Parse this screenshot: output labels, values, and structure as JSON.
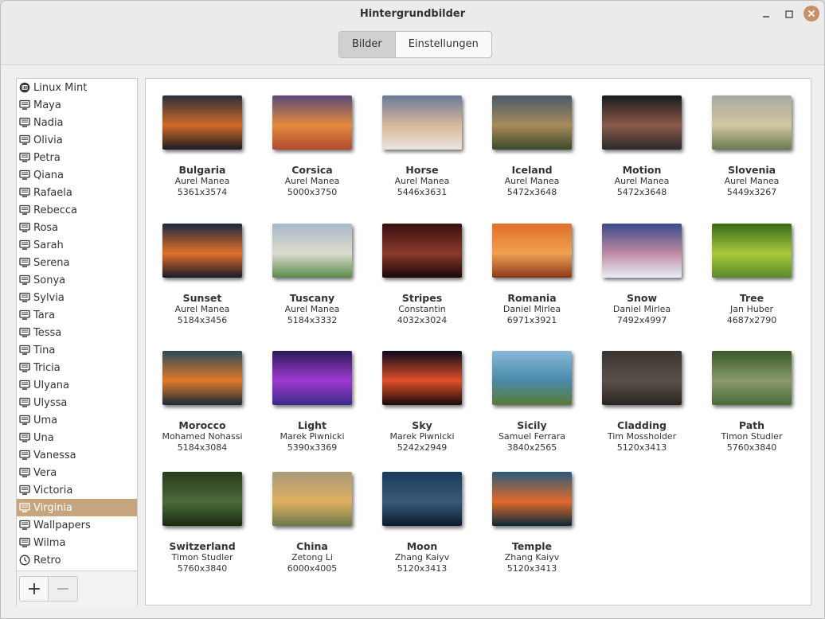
{
  "window": {
    "title": "Hintergrundbilder"
  },
  "tabs": [
    {
      "label": "Bilder",
      "active": true
    },
    {
      "label": "Einstellungen",
      "active": false
    }
  ],
  "sidebar": {
    "items": [
      {
        "label": "Linux Mint",
        "icon": "mint-logo-icon"
      },
      {
        "label": "Maya",
        "icon": "monitor-icon"
      },
      {
        "label": "Nadia",
        "icon": "monitor-icon"
      },
      {
        "label": "Olivia",
        "icon": "monitor-icon"
      },
      {
        "label": "Petra",
        "icon": "monitor-icon"
      },
      {
        "label": "Qiana",
        "icon": "monitor-icon"
      },
      {
        "label": "Rafaela",
        "icon": "monitor-icon"
      },
      {
        "label": "Rebecca",
        "icon": "monitor-icon"
      },
      {
        "label": "Rosa",
        "icon": "monitor-icon"
      },
      {
        "label": "Sarah",
        "icon": "monitor-icon"
      },
      {
        "label": "Serena",
        "icon": "monitor-icon"
      },
      {
        "label": "Sonya",
        "icon": "monitor-icon"
      },
      {
        "label": "Sylvia",
        "icon": "monitor-icon"
      },
      {
        "label": "Tara",
        "icon": "monitor-icon"
      },
      {
        "label": "Tessa",
        "icon": "monitor-icon"
      },
      {
        "label": "Tina",
        "icon": "monitor-icon"
      },
      {
        "label": "Tricia",
        "icon": "monitor-icon"
      },
      {
        "label": "Ulyana",
        "icon": "monitor-icon"
      },
      {
        "label": "Ulyssa",
        "icon": "monitor-icon"
      },
      {
        "label": "Uma",
        "icon": "monitor-icon"
      },
      {
        "label": "Una",
        "icon": "monitor-icon"
      },
      {
        "label": "Vanessa",
        "icon": "monitor-icon"
      },
      {
        "label": "Vera",
        "icon": "monitor-icon"
      },
      {
        "label": "Victoria",
        "icon": "monitor-icon"
      },
      {
        "label": "Virginia",
        "icon": "monitor-icon",
        "selected": true
      },
      {
        "label": "Wallpapers",
        "icon": "monitor-icon"
      },
      {
        "label": "Wilma",
        "icon": "monitor-icon"
      },
      {
        "label": "Retro",
        "icon": "clock-icon"
      }
    ],
    "add_label": "+",
    "remove_label": "−"
  },
  "wallpapers": [
    {
      "name": "Bulgaria",
      "author": "Aurel Manea",
      "size": "5361x3574",
      "colors": [
        "#2a2f3a",
        "#d06a2a",
        "#1b1b22"
      ]
    },
    {
      "name": "Corsica",
      "author": "Aurel Manea",
      "size": "5000x3750",
      "colors": [
        "#5a4a7a",
        "#e38a3c",
        "#b04a32"
      ]
    },
    {
      "name": "Horse",
      "author": "Aurel Manea",
      "size": "5446x3631",
      "colors": [
        "#6a7a9a",
        "#d8b89a",
        "#eae4de"
      ]
    },
    {
      "name": "Iceland",
      "author": "Aurel Manea",
      "size": "5472x3648",
      "colors": [
        "#4a5a6a",
        "#a88a5a",
        "#3a4a2a"
      ]
    },
    {
      "name": "Motion",
      "author": "Aurel Manea",
      "size": "5472x3648",
      "colors": [
        "#1a1a1a",
        "#8a5a4a",
        "#2a2a2a"
      ]
    },
    {
      "name": "Slovenia",
      "author": "Aurel Manea",
      "size": "5449x3267",
      "colors": [
        "#a8a8a0",
        "#d0c8a0",
        "#6a7a50"
      ]
    },
    {
      "name": "Sunset",
      "author": "Aurel Manea",
      "size": "5184x3456",
      "colors": [
        "#1a2a40",
        "#e0702a",
        "#1a1a2a"
      ]
    },
    {
      "name": "Tuscany",
      "author": "Aurel Manea",
      "size": "5184x3332",
      "colors": [
        "#a8b8c8",
        "#dcdcd0",
        "#5a8a4a"
      ]
    },
    {
      "name": "Stripes",
      "author": "Constantin",
      "size": "4032x3024",
      "colors": [
        "#3a1010",
        "#8a3a2a",
        "#1a0808"
      ]
    },
    {
      "name": "Romania",
      "author": "Daniel Mirlea",
      "size": "6971x3921",
      "colors": [
        "#e0702a",
        "#f0a050",
        "#8a3a1a"
      ]
    },
    {
      "name": "Snow",
      "author": "Daniel Mirlea",
      "size": "7492x4997",
      "colors": [
        "#3a4a8a",
        "#c08aa0",
        "#e8eef8"
      ]
    },
    {
      "name": "Tree",
      "author": "Jan Huber",
      "size": "4687x2790",
      "colors": [
        "#3a6a1a",
        "#a8c83a",
        "#5a8a2a"
      ]
    },
    {
      "name": "Morocco",
      "author": "Mohamed Nohassi",
      "size": "5184x3084",
      "colors": [
        "#2a4a5a",
        "#e07a2a",
        "#1a2a3a"
      ]
    },
    {
      "name": "Light",
      "author": "Marek Piwnicki",
      "size": "5390x3369",
      "colors": [
        "#2a1a5a",
        "#a03ad0",
        "#3a2a8a"
      ]
    },
    {
      "name": "Sky",
      "author": "Marek Piwnicki",
      "size": "5242x2949",
      "colors": [
        "#0a0a1a",
        "#e0502a",
        "#1a0a0a"
      ]
    },
    {
      "name": "Sicily",
      "author": "Samuel Ferrara",
      "size": "3840x2565",
      "colors": [
        "#8ab8d8",
        "#4a8aa8",
        "#5a7a3a"
      ]
    },
    {
      "name": "Cladding",
      "author": "Tim Mossholder",
      "size": "5120x3413",
      "colors": [
        "#3a3430",
        "#5a5048",
        "#2a2420"
      ]
    },
    {
      "name": "Path",
      "author": "Timon Studler",
      "size": "5760x3840",
      "colors": [
        "#3a5a2a",
        "#8a9a6a",
        "#4a6a3a"
      ]
    },
    {
      "name": "Switzerland",
      "author": "Timon Studler",
      "size": "5760x3840",
      "colors": [
        "#2a3a1a",
        "#4a6a3a",
        "#1a2a10"
      ]
    },
    {
      "name": "China",
      "author": "Zetong Li",
      "size": "6000x4005",
      "colors": [
        "#a89a7a",
        "#e0b060",
        "#6a7a4a"
      ]
    },
    {
      "name": "Moon",
      "author": "Zhang Kaiyv",
      "size": "5120x3413",
      "colors": [
        "#1a3a5a",
        "#3a5a7a",
        "#0a1a2a"
      ]
    },
    {
      "name": "Temple",
      "author": "Zhang Kaiyv",
      "size": "5120x3413",
      "colors": [
        "#2a5a7a",
        "#e06a2a",
        "#0a2a3a"
      ]
    }
  ]
}
